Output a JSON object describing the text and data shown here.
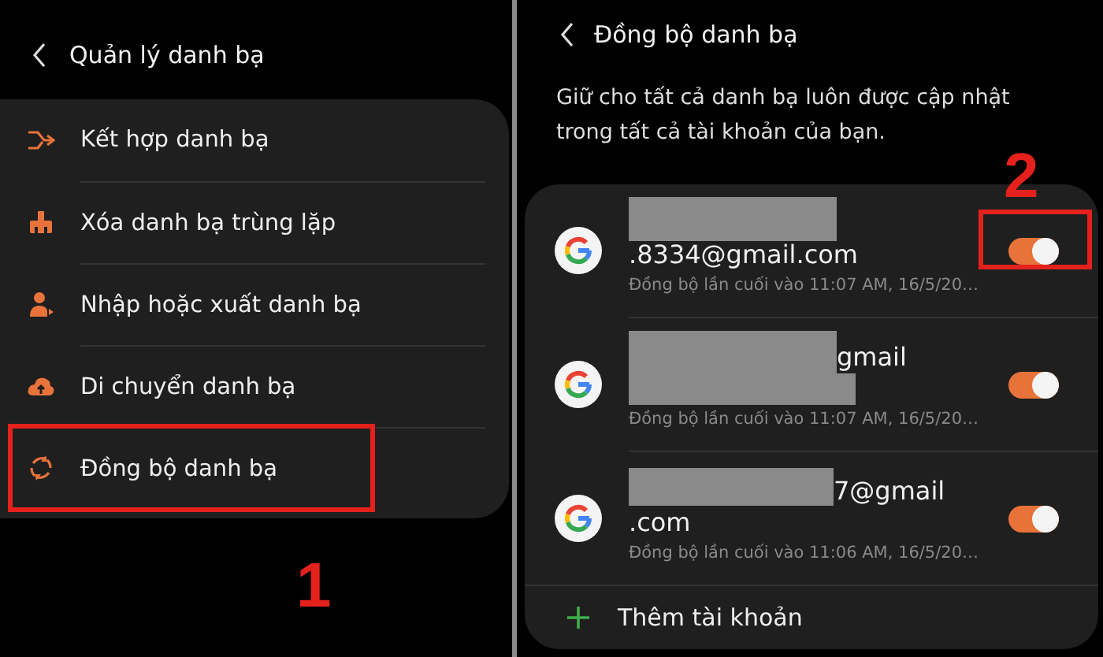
{
  "left_screen": {
    "title": "Quản lý danh bạ",
    "menu_items": [
      {
        "label": "Kết hợp danh bạ",
        "highlighted": false
      },
      {
        "label": "Xóa danh bạ trùng lặp",
        "highlighted": false
      },
      {
        "label": "Nhập hoặc xuất danh bạ",
        "highlighted": false
      },
      {
        "label": "Di chuyển danh bạ",
        "highlighted": false
      },
      {
        "label": "Đồng bộ danh bạ",
        "highlighted": true,
        "callout": "1"
      }
    ]
  },
  "right_screen": {
    "title": "Đồng bộ danh bạ",
    "description": "Giữ cho tất cả danh bạ luôn được cập nhật trong tất cả tài khoản của bạn.",
    "accounts": [
      {
        "name_lines": [
          [
            {
              "kind": "redacted"
            }
          ],
          [
            {
              "kind": "text",
              "text": ".8334@gmail.com"
            }
          ]
        ],
        "last_sync": "Đồng bộ lần cuối vào 11:07 AM, 16/5/20…",
        "on": true,
        "highlighted": true,
        "callout": "2"
      },
      {
        "name_lines": [
          [
            {
              "kind": "redacted"
            },
            {
              "kind": "text",
              "text": "gmail"
            }
          ],
          [
            {
              "kind": "redacted"
            }
          ]
        ],
        "last_sync": "Đồng bộ lần cuối vào 11:07 AM, 16/5/20…",
        "on": true,
        "highlighted": false
      },
      {
        "name_lines": [
          [
            {
              "kind": "redacted"
            },
            {
              "kind": "text",
              "text": "7@gmail"
            }
          ],
          [
            {
              "kind": "text",
              "text": ".com"
            }
          ]
        ],
        "last_sync": "Đồng bộ lần cuối vào 11:06 AM, 16/5/20…",
        "on": true,
        "highlighted": false
      }
    ],
    "add_account": "Thêm tài khoản"
  }
}
